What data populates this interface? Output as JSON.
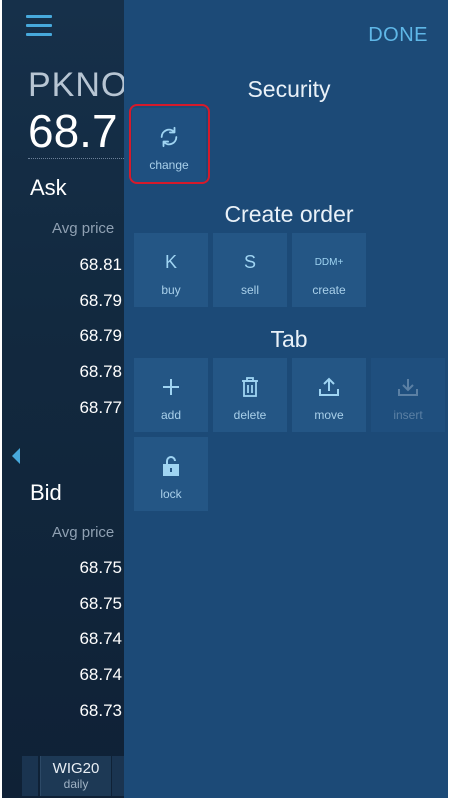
{
  "background": {
    "ticker": "PKNOI",
    "last_price": "68.7",
    "ask_label": "Ask",
    "bid_label": "Bid",
    "avg_price_label": "Avg price",
    "ask_prices": [
      "68.81",
      "68.79",
      "68.79",
      "68.78",
      "68.77"
    ],
    "bid_prices": [
      "68.75",
      "68.75",
      "68.74",
      "68.74",
      "68.73"
    ],
    "bottom_tab": {
      "name": "WIG20",
      "sub": "daily"
    }
  },
  "menu": {
    "done_label": "DONE",
    "security": {
      "heading": "Security",
      "change_label": "change"
    },
    "create_order": {
      "heading": "Create order",
      "items": [
        {
          "glyph": "K",
          "label": "buy"
        },
        {
          "glyph": "S",
          "label": "sell"
        },
        {
          "glyph": "DDM+",
          "label": "create"
        }
      ]
    },
    "tab": {
      "heading": "Tab",
      "items": [
        {
          "icon": "plus-icon",
          "label": "add"
        },
        {
          "icon": "trash-icon",
          "label": "delete"
        },
        {
          "icon": "upload-icon",
          "label": "move"
        },
        {
          "icon": "download-icon",
          "label": "insert"
        },
        {
          "icon": "lock-icon",
          "label": "lock"
        }
      ]
    }
  },
  "colors": {
    "accent": "#47a9dc",
    "panel": "#1c4a77",
    "tile": "#245685",
    "selection_outline": "#d61a2b"
  }
}
